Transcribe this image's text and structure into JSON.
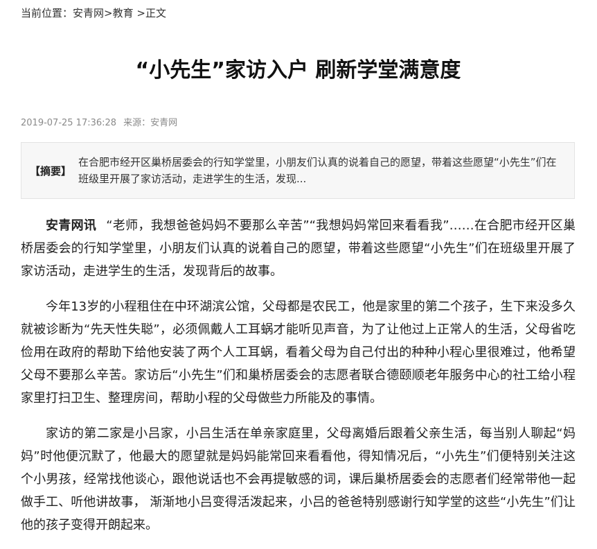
{
  "breadcrumb": {
    "prefix": "当前位置：",
    "site": "安青网",
    "sep1": ">",
    "section": "教育",
    "sep2": " >",
    "current": "正文"
  },
  "article": {
    "title": "“小先生”家访入户 刷新学堂满意度",
    "datetime": "2019-07-25 17:36:28",
    "source": "来源：安青网",
    "summary_label": "【摘要】",
    "summary": "在合肥市经开区巢桥居委会的行知学堂里，小朋友们认真的说着自己的愿望，带着这些愿望“小先生”们在班级里开展了家访活动，走进学生的生活，发现...",
    "lead": "安青网讯",
    "paragraphs": [
      "“老师，我想爸爸妈妈不要那么辛苦”“我想妈妈常回来看看我”……在合肥市经开区巢桥居委会的行知学堂里，小朋友们认真的说着自己的愿望，带着这些愿望“小先生”们在班级里开展了家访活动，走进学生的生活，发现背后的故事。",
      "今年13岁的小程租住在中环湖滨公馆，父母都是农民工，他是家里的第二个孩子，生下来没多久就被诊断为“先天性失聪”，必须佩戴人工耳蜗才能听见声音，为了让他过上正常人的生活，父母省吃俭用在政府的帮助下给他安装了两个人工耳蜗，看着父母为自己付出的种种小程心里很难过，他希望父母不要那么辛苦。家访后“小先生”们和巢桥居委会的志愿者联合德颐顺老年服务中心的社工给小程家里打扫卫生、整理房间，帮助小程的父母做些力所能及的事情。",
      "家访的第二家是小吕家，小吕生活在单亲家庭里，父母离婚后跟着父亲生活，每当别人聊起“妈妈”时他便沉默了，他最大的愿望就是妈妈能常回来看看他，得知情况后，“小先生”们便特别关注这个小男孩，经常找他谈心，跟他说话也不会再提敏感的词，课后巢桥居委会的志愿者们经常带他一起做手工、听他讲故事， 渐渐地小吕变得活泼起来，小吕的爸爸特别感谢行知学堂的这些“小先生”们让他的孩子变得开朗起来。"
    ]
  }
}
